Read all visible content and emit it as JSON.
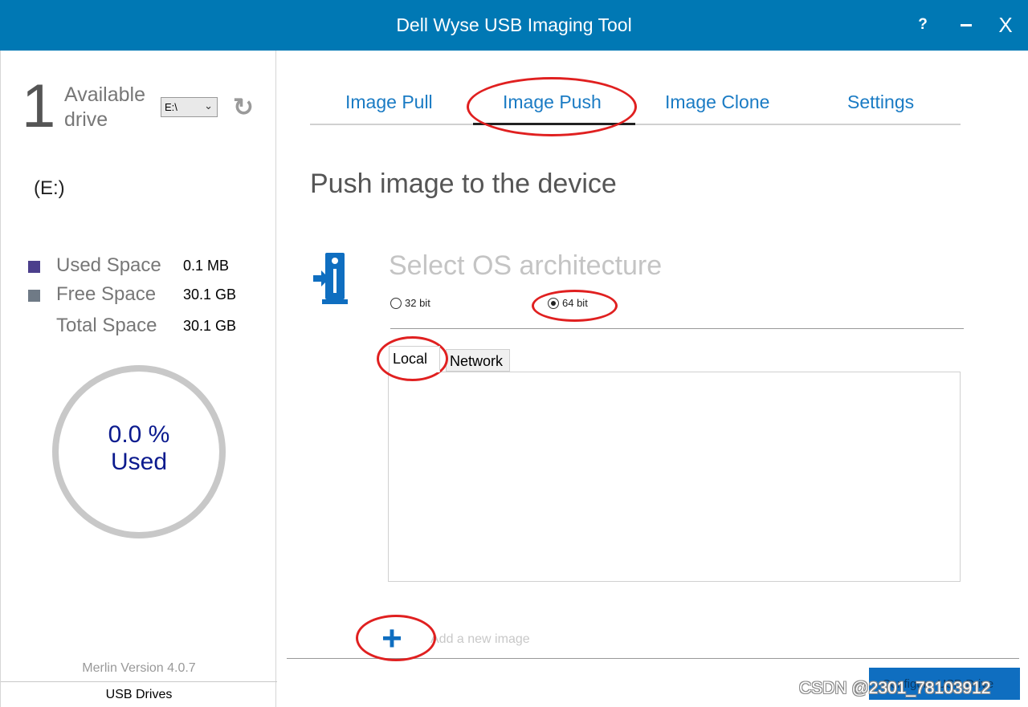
{
  "window": {
    "title": "Dell Wyse USB Imaging Tool",
    "help_label": "?",
    "minimize_label": "-",
    "close_label": "X"
  },
  "sidebar": {
    "drive_count": "1",
    "available_label": "Available drive",
    "drive_select_value": "E:\\",
    "drive_letter": "(E:)",
    "legend": [
      {
        "label": "Used Space",
        "value": "0.1 MB",
        "color": "#4b3f8c"
      },
      {
        "label": "Free Space",
        "value": "30.1 GB",
        "color": "#6f7a86"
      },
      {
        "label": "Total Space",
        "value": "30.1 GB",
        "color": ""
      }
    ],
    "usage_percent_text": "0.0 %",
    "usage_used_text": "Used",
    "version": "Merlin Version 4.0.7",
    "usb_drives_label": "USB Drives"
  },
  "tabs": {
    "items": [
      "Image Pull",
      "Image Push",
      "Image Clone",
      "Settings"
    ],
    "active": "Image Push"
  },
  "main": {
    "page_title": "Push image to the device",
    "arch_title": "Select OS architecture",
    "radio_32": "32 bit",
    "radio_64": "64 bit",
    "selected_arch": "64 bit",
    "subtab_local": "Local",
    "subtab_network": "Network",
    "add_image_text": "Add a new image",
    "configure_button": "Configure USB Drive"
  },
  "watermark": "CSDN @2301_78103912",
  "colors": {
    "titlebar": "#0078b4",
    "accent": "#0f6ec0",
    "annotation": "#e02020"
  }
}
